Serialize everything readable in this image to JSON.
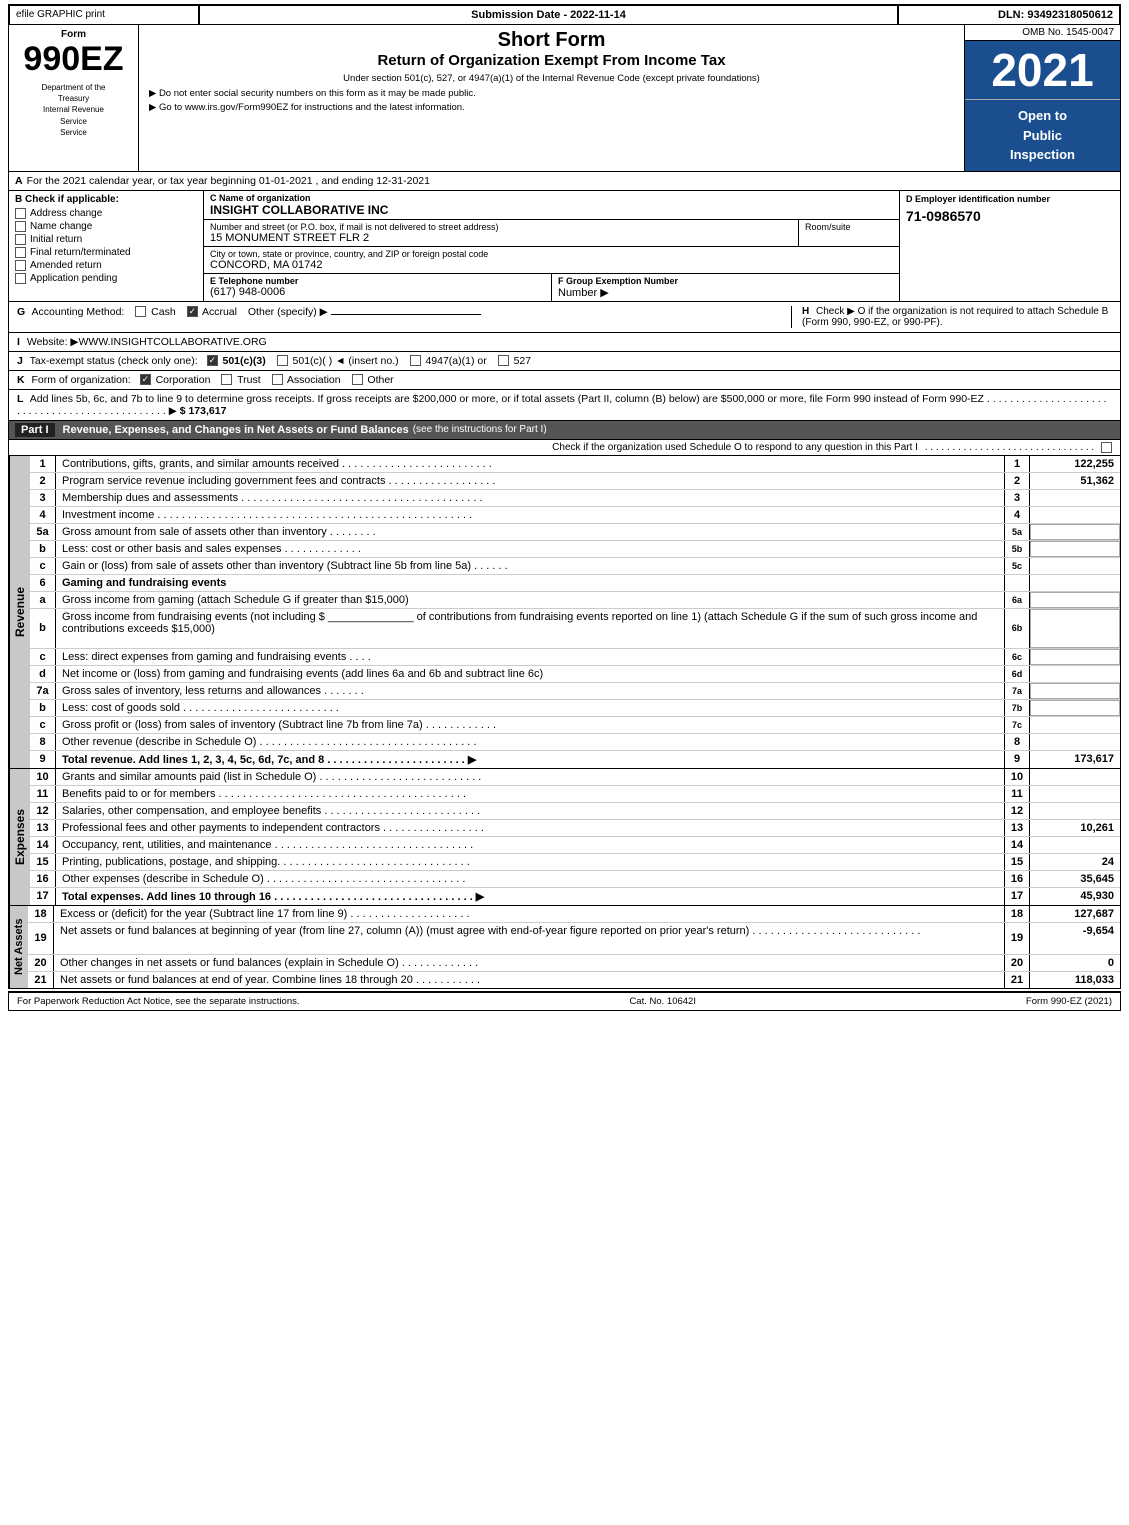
{
  "header": {
    "efile_label": "efile GRAPHIC print",
    "submission_date_label": "Submission Date - 2022-11-14",
    "dln_label": "DLN: 93492318050612"
  },
  "form": {
    "number": "990EZ",
    "dept_line1": "Department of the",
    "dept_line2": "Treasury",
    "dept_line3": "Internal Revenue",
    "dept_line4": "Service",
    "title": "Short Form",
    "subtitle": "Return of Organization Exempt From Income Tax",
    "instruction1": "Under section 501(c), 527, or 4947(a)(1) of the Internal Revenue Code (except private foundations)",
    "instruction2": "▶ Do not enter social security numbers on this form as it may be made public.",
    "instruction3": "▶ Go to www.irs.gov/Form990EZ for instructions and the latest information.",
    "omb": "OMB No. 1545-0047",
    "year": "2021",
    "open_to_public": "Open to\nPublic\nInspection"
  },
  "section_a": {
    "label": "A",
    "text": "For the 2021 calendar year, or tax year beginning 01-01-2021 , and ending 12-31-2021"
  },
  "section_b": {
    "label": "B",
    "title": "Check if applicable:",
    "items": [
      {
        "id": "address_change",
        "label": "Address change",
        "checked": false
      },
      {
        "id": "name_change",
        "label": "Name change",
        "checked": false
      },
      {
        "id": "initial_return",
        "label": "Initial return",
        "checked": false
      },
      {
        "id": "final_return",
        "label": "Final return/terminated",
        "checked": false
      },
      {
        "id": "amended_return",
        "label": "Amended return",
        "checked": false
      },
      {
        "id": "application_pending",
        "label": "Application pending",
        "checked": false
      }
    ]
  },
  "section_c": {
    "label": "C",
    "name_label": "Name of organization",
    "name": "INSIGHT COLLABORATIVE INC",
    "address_label": "Number and street (or P.O. box, if mail is not delivered to street address)",
    "address": "15 MONUMENT STREET FLR 2",
    "room_label": "Room/suite",
    "room": "",
    "city_label": "City or town, state or province, country, and ZIP or foreign postal code",
    "city": "CONCORD, MA  01742"
  },
  "section_d": {
    "label": "D",
    "title": "Employer identification number",
    "ein": "71-0986570"
  },
  "section_e": {
    "label": "E",
    "title": "Telephone number",
    "phone": "(617) 948-0006"
  },
  "section_f": {
    "label": "F",
    "title": "Group Exemption Number",
    "arrow": "▶"
  },
  "section_g": {
    "label": "G",
    "text": "Accounting Method:",
    "cash": "Cash",
    "accrual": "Accrual",
    "other": "Other (specify) ▶",
    "accrual_checked": true
  },
  "section_h": {
    "label": "H",
    "text": "Check ▶  O if the organization is not required to attach Schedule B (Form 990, 990-EZ, or 990-PF)."
  },
  "section_i": {
    "label": "I",
    "text": "Website: ▶WWW.INSIGHTCOLLABORATIVE.ORG"
  },
  "section_j": {
    "label": "J",
    "text": "Tax-exempt status (check only one):",
    "options": [
      "501(c)(3)",
      "501(c)(  ) ◄ (insert no.)",
      "4947(a)(1) or",
      "527"
    ],
    "checked": "501(c)(3)"
  },
  "section_k": {
    "label": "K",
    "text": "Form of organization:",
    "options": [
      "Corporation",
      "Trust",
      "Association",
      "Other"
    ],
    "checked": "Corporation"
  },
  "section_l": {
    "label": "L",
    "text": "Add lines 5b, 6c, and 7b to line 9 to determine gross receipts. If gross receipts are $200,000 or more, or if total assets (Part II, column (B) below) are $500,000 or more, file Form 990 instead of Form 990-EZ",
    "dots": ". . . . . . . . . . . . . . . . . . . . . . . . . . . . . . . . . . . . . . . . . . . . . . .",
    "arrow": "▶",
    "amount": "$ 173,617"
  },
  "part_i": {
    "label": "Part I",
    "title": "Revenue, Expenses, and Changes in Net Assets or Fund Balances",
    "subtitle": "(see the instructions for Part I)",
    "check_text": "Check if the organization used Schedule O to respond to any question in this Part I",
    "side_label": "Revenue",
    "rows": [
      {
        "line": "1",
        "label": "Contributions, gifts, grants, and similar amounts received . . . . . . . . . . . . . . . . . . . . . . . . .",
        "line_num": "1",
        "amount": "122,255"
      },
      {
        "line": "2",
        "label": "Program service revenue including government fees and contracts . . . . . . . . . . . . . . . . . .",
        "line_num": "2",
        "amount": "51,362"
      },
      {
        "line": "3",
        "label": "Membership dues and assessments . . . . . . . . . . . . . . . . . . . . . . . . . . . . . . . . . . . . . . . .",
        "line_num": "3",
        "amount": ""
      },
      {
        "line": "4",
        "label": "Investment income . . . . . . . . . . . . . . . . . . . . . . . . . . . . . . . . . . . . . . . . . . . . . . . . . . . .",
        "line_num": "4",
        "amount": ""
      },
      {
        "line": "5a",
        "label": "Gross amount from sale of assets other than inventory . . . . . . . .",
        "sub_label": "5a",
        "line_num": "",
        "amount": ""
      },
      {
        "line": "5b",
        "label": "Less: cost or other basis and sales expenses . . . . . . . . . . . . .",
        "sub_label": "5b",
        "line_num": "",
        "amount": ""
      },
      {
        "line": "5c",
        "label": "Gain or (loss) from sale of assets other than inventory (Subtract line 5b from line 5a) . . . . . .",
        "line_num": "5c",
        "amount": ""
      },
      {
        "line": "6",
        "label": "Gaming and fundraising events",
        "line_num": "",
        "amount": ""
      },
      {
        "line": "6a",
        "label": "Gross income from gaming (attach Schedule G if greater than $15,000)",
        "sub_label": "6a",
        "line_num": "",
        "amount": ""
      },
      {
        "line": "6b",
        "label": "Gross income from fundraising events (not including $ ______________ of contributions from fundraising events reported on line 1) (attach Schedule G if the sum of such gross income and contributions exceeds $15,000)",
        "sub_label": "6b",
        "line_num": "",
        "amount": ""
      },
      {
        "line": "6c",
        "label": "Less: direct expenses from gaming and fundraising events . . . .",
        "sub_label": "6c",
        "line_num": "",
        "amount": ""
      },
      {
        "line": "6d",
        "label": "Net income or (loss) from gaming and fundraising events (add lines 6a and 6b and subtract line 6c)",
        "line_num": "6d",
        "amount": ""
      },
      {
        "line": "7a",
        "label": "Gross sales of inventory, less returns and allowances . . . . . . .",
        "sub_label": "7a",
        "line_num": "",
        "amount": ""
      },
      {
        "line": "7b",
        "label": "Less: cost of goods sold . . . . . . . . . . . . . . . . . . . . . . . . . .",
        "sub_label": "7b",
        "line_num": "",
        "amount": ""
      },
      {
        "line": "7c",
        "label": "Gross profit or (loss) from sales of inventory (Subtract line 7b from line 7a) . . . . . . . . . . . .",
        "line_num": "7c",
        "amount": ""
      },
      {
        "line": "8",
        "label": "Other revenue (describe in Schedule O) . . . . . . . . . . . . . . . . . . . . . . . . . . . . . . . . . . . .",
        "line_num": "8",
        "amount": ""
      },
      {
        "line": "9",
        "label": "Total revenue. Add lines 1, 2, 3, 4, 5c, 6d, 7c, and 8 . . . . . . . . . . . . . . . . . . . . . . . ▶",
        "line_num": "9",
        "amount": "173,617",
        "bold": true
      }
    ]
  },
  "part_i_expenses": {
    "side_label": "Expenses",
    "rows": [
      {
        "line": "10",
        "label": "Grants and similar amounts paid (list in Schedule O) . . . . . . . . . . . . . . . . . . . . . . . . . . .",
        "line_num": "10",
        "amount": ""
      },
      {
        "line": "11",
        "label": "Benefits paid to or for members . . . . . . . . . . . . . . . . . . . . . . . . . . . . . . . . . . . . . . . . .",
        "line_num": "11",
        "amount": ""
      },
      {
        "line": "12",
        "label": "Salaries, other compensation, and employee benefits . . . . . . . . . . . . . . . . . . . . . . . . . .",
        "line_num": "12",
        "amount": ""
      },
      {
        "line": "13",
        "label": "Professional fees and other payments to independent contractors . . . . . . . . . . . . . . . . .",
        "line_num": "13",
        "amount": "10,261"
      },
      {
        "line": "14",
        "label": "Occupancy, rent, utilities, and maintenance . . . . . . . . . . . . . . . . . . . . . . . . . . . . . . . . .",
        "line_num": "14",
        "amount": ""
      },
      {
        "line": "15",
        "label": "Printing, publications, postage, and shipping. . . . . . . . . . . . . . . . . . . . . . . . . . . . . . . .",
        "line_num": "15",
        "amount": "24"
      },
      {
        "line": "16",
        "label": "Other expenses (describe in Schedule O) . . . . . . . . . . . . . . . . . . . . . . . . . . . . . . . . .",
        "line_num": "16",
        "amount": "35,645"
      },
      {
        "line": "17",
        "label": "Total expenses. Add lines 10 through 16 . . . . . . . . . . . . . . . . . . . . . . . . . . . . . . . . . ▶",
        "line_num": "17",
        "amount": "45,930",
        "bold": true
      }
    ]
  },
  "part_i_net_assets": {
    "side_label": "Net Assets",
    "rows": [
      {
        "line": "18",
        "label": "Excess or (deficit) for the year (Subtract line 17 from line 9) . . . . . . . . . . . . . . . . . . . .",
        "line_num": "18",
        "amount": "127,687"
      },
      {
        "line": "19",
        "label": "Net assets or fund balances at beginning of year (from line 27, column (A)) (must agree with end-of-year figure reported on prior year's return) . . . . . . . . . . . . . . . . . . . . . . . . . . . .",
        "line_num": "19",
        "amount": "-9,654"
      },
      {
        "line": "20",
        "label": "Other changes in net assets or fund balances (explain in Schedule O) . . . . . . . . . . . . .",
        "line_num": "20",
        "amount": "0"
      },
      {
        "line": "21",
        "label": "Net assets or fund balances at end of year. Combine lines 18 through 20 . . . . . . . . . . .",
        "line_num": "21",
        "amount": "118,033"
      }
    ]
  },
  "footer": {
    "left": "For Paperwork Reduction Act Notice, see the separate instructions.",
    "center": "Cat. No. 10642I",
    "right": "Form 990-EZ (2021)"
  }
}
